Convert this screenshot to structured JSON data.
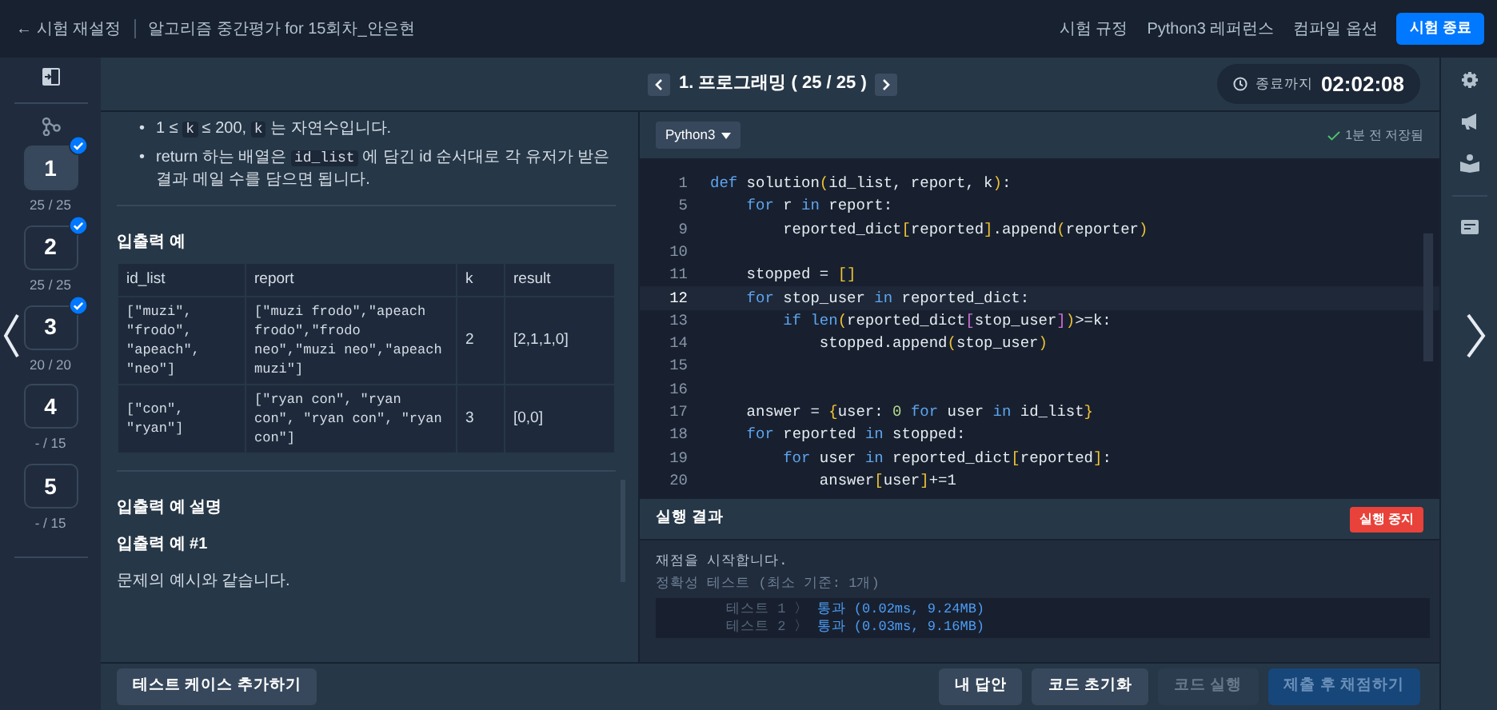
{
  "topbar": {
    "back": "← 시험 재설정",
    "title": "알고리즘 중간평가 for 15회차_안은현",
    "links": [
      "시험 규정",
      "Python3 레퍼런스",
      "컴파일 옵션"
    ],
    "end_button": "시험 종료"
  },
  "problems": [
    {
      "number": "1",
      "score": "25 / 25",
      "done": true,
      "selected": true
    },
    {
      "number": "2",
      "score": "25 / 25",
      "done": true,
      "selected": false
    },
    {
      "number": "3",
      "score": "20 / 20",
      "done": true,
      "selected": false
    },
    {
      "number": "4",
      "score": "- / 15",
      "done": false,
      "selected": false
    },
    {
      "number": "5",
      "score": "- / 15",
      "done": false,
      "selected": false
    }
  ],
  "header": {
    "title": "1. 프로그래밍 ( 25 / 25 )",
    "timer_label": "종료까지",
    "timer": "02:02:08"
  },
  "description": {
    "bullets": [
      {
        "marker": "•",
        "parts": [
          {
            "text": "1 ≤ ",
            "kind": "text"
          },
          {
            "text": "k",
            "kind": "code"
          },
          {
            "text": " ≤ 200, ",
            "kind": "text"
          },
          {
            "text": "k",
            "kind": "code"
          },
          {
            "text": " 는 자연수입니다.",
            "kind": "text"
          }
        ]
      },
      {
        "marker": "•",
        "parts": [
          {
            "text": "return 하는 배열은 ",
            "kind": "text"
          },
          {
            "text": "id_list",
            "kind": "code"
          },
          {
            "text": " 에 담긴 id 순서대로 각 유저가 받은 결과 메일 수를 담으면 됩니다.",
            "kind": "text"
          }
        ]
      }
    ],
    "example_heading": "입출력 예",
    "table": {
      "columns": [
        "id_list",
        "report",
        "k",
        "result"
      ],
      "rows": [
        [
          "[\"muzi\", \"frodo\", \"apeach\", \"neo\"]",
          "[\"muzi frodo\",\"apeach frodo\",\"frodo neo\",\"muzi neo\",\"apeach muzi\"]",
          "2",
          "[2,1,1,0]"
        ],
        [
          "[\"con\", \"ryan\"]",
          "[\"ryan con\", \"ryan con\", \"ryan con\", \"ryan con\"]",
          "3",
          "[0,0]"
        ]
      ]
    },
    "explain_heading": "입출력 예 설명",
    "example_title": "입출력 예 #1",
    "example_text": "문제의 예시와 같습니다."
  },
  "editor": {
    "language": "Python3",
    "saved": "1분 전 저장됨",
    "lines": [
      {
        "n": "1",
        "tokens": [
          {
            "text": "def",
            "kind": "kw"
          },
          {
            "text": " solution",
            "kind": "p"
          },
          {
            "text": "(",
            "kind": "br"
          },
          {
            "text": "id_list, report, k",
            "kind": "p"
          },
          {
            "text": ")",
            "kind": "br"
          },
          {
            "text": ":",
            "kind": "p"
          }
        ]
      },
      {
        "n": "5",
        "tokens": [
          {
            "text": "    for",
            "kind": "kw"
          },
          {
            "text": " r ",
            "kind": "p"
          },
          {
            "text": "in",
            "kind": "kw"
          },
          {
            "text": " report:",
            "kind": "p"
          }
        ]
      },
      {
        "n": "9",
        "tokens": [
          {
            "text": "        reported_dict",
            "kind": "p"
          },
          {
            "text": "[",
            "kind": "br"
          },
          {
            "text": "reported",
            "kind": "p"
          },
          {
            "text": "]",
            "kind": "br"
          },
          {
            "text": ".append",
            "kind": "p"
          },
          {
            "text": "(",
            "kind": "br"
          },
          {
            "text": "reporter",
            "kind": "p"
          },
          {
            "text": ")",
            "kind": "br"
          }
        ]
      },
      {
        "n": "10"
      },
      {
        "n": "11",
        "tokens": [
          {
            "text": "    stopped = ",
            "kind": "p"
          },
          {
            "text": "[]",
            "kind": "br"
          }
        ]
      },
      {
        "n": "12",
        "current": true,
        "tokens": [
          {
            "text": "    for",
            "kind": "kw"
          },
          {
            "text": " stop_user ",
            "kind": "p"
          },
          {
            "text": "in",
            "kind": "kw"
          },
          {
            "text": " reported_dict:",
            "kind": "p"
          }
        ]
      },
      {
        "n": "13",
        "tokens": [
          {
            "text": "        if len",
            "kind": "kw"
          },
          {
            "text": "(",
            "kind": "br"
          },
          {
            "text": "reported_dict",
            "kind": "p"
          },
          {
            "text": "[",
            "kind": "br2"
          },
          {
            "text": "stop_user",
            "kind": "p"
          },
          {
            "text": "]",
            "kind": "br2"
          },
          {
            "text": ")",
            "kind": "br"
          },
          {
            "text": ">=k:",
            "kind": "p"
          }
        ]
      },
      {
        "n": "14",
        "tokens": [
          {
            "text": "            stopped.append",
            "kind": "p"
          },
          {
            "text": "(",
            "kind": "br"
          },
          {
            "text": "stop_user",
            "kind": "p"
          },
          {
            "text": ")",
            "kind": "br"
          }
        ]
      },
      {
        "n": "15"
      },
      {
        "n": "16"
      },
      {
        "n": "17",
        "tokens": [
          {
            "text": "    answer = ",
            "kind": "p"
          },
          {
            "text": "{",
            "kind": "br"
          },
          {
            "text": "user: ",
            "kind": "p"
          },
          {
            "text": "0",
            "kind": "num"
          },
          {
            "text": " for",
            "kind": "kw"
          },
          {
            "text": " user ",
            "kind": "p"
          },
          {
            "text": "in",
            "kind": "kw"
          },
          {
            "text": " id_list",
            "kind": "p"
          },
          {
            "text": "}",
            "kind": "br"
          }
        ]
      },
      {
        "n": "18",
        "tokens": [
          {
            "text": "    for",
            "kind": "kw"
          },
          {
            "text": " reported ",
            "kind": "p"
          },
          {
            "text": "in",
            "kind": "kw"
          },
          {
            "text": " stopped:",
            "kind": "p"
          }
        ]
      },
      {
        "n": "19",
        "tokens": [
          {
            "text": "        for",
            "kind": "kw"
          },
          {
            "text": " user ",
            "kind": "p"
          },
          {
            "text": "in",
            "kind": "kw"
          },
          {
            "text": " reported_dict",
            "kind": "p"
          },
          {
            "text": "[",
            "kind": "br"
          },
          {
            "text": "reported",
            "kind": "p"
          },
          {
            "text": "]",
            "kind": "br"
          },
          {
            "text": ":",
            "kind": "p"
          }
        ]
      },
      {
        "n": "20",
        "tokens": [
          {
            "text": "            answer",
            "kind": "p"
          },
          {
            "text": "[",
            "kind": "br"
          },
          {
            "text": "user",
            "kind": "p"
          },
          {
            "text": "]",
            "kind": "br"
          },
          {
            "text": "+=1",
            "kind": "p"
          }
        ]
      }
    ]
  },
  "results": {
    "title": "실행 결과",
    "stop_button": "실행 중지",
    "start": "재점을 시작합니다.",
    "section": "정확성 테스트 (최소 기준: 1개)",
    "tests": [
      {
        "name": "테스트 1 〉",
        "result": "통과 (0.02ms, 9.24MB)"
      },
      {
        "name": "테스트 2 〉",
        "result": "통과 (0.03ms, 9.16MB)"
      }
    ]
  },
  "footer": {
    "add_case": "테스트 케이스 추가하기",
    "buttons": [
      {
        "label": "내 답안",
        "disabled": false,
        "kind": "secondary"
      },
      {
        "label": "코드 초기화",
        "disabled": false,
        "kind": "secondary"
      },
      {
        "label": "코드 실행",
        "disabled": true,
        "kind": "secondary"
      },
      {
        "label": "제출 후 채점하기",
        "disabled": true,
        "kind": "primary"
      }
    ]
  }
}
